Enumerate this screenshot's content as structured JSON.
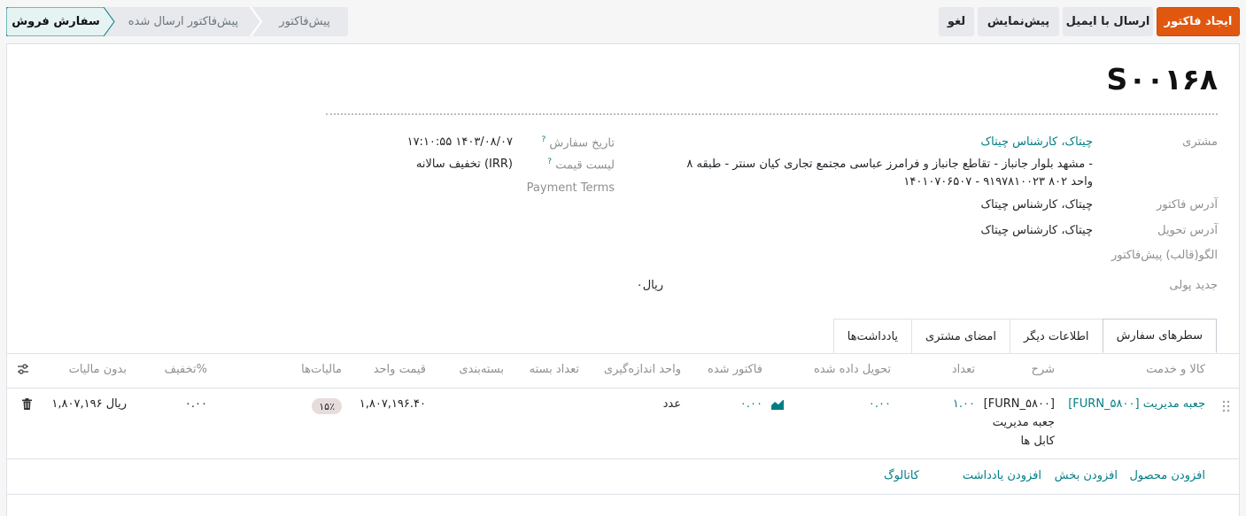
{
  "buttons": {
    "create_invoice": "ایجاد فاکتور",
    "send_email": "ارسال با ایمیل",
    "preview": "پیش‌نمایش",
    "cancel": "لغو"
  },
  "stages": {
    "items": [
      "پیش‌فاکتور",
      "پیش‌فاکتور ارسال شده",
      "سفارش فروش"
    ],
    "active": "سفارش فروش"
  },
  "form": {
    "title": "S۰۰۱۶۸",
    "customer_label": "مشتری",
    "customer_name": "چیتاک، کارشناس چیتاک",
    "customer_address_1": "مشهد بلوار جانباز - تقاطع جانباز و فرامرز عباسی مجتمع تجاری کیان سنتر - طبقه ۸ -",
    "customer_address_2": "واحد ۸۰۲ ۹۱۹۷۸۱۰۰۲۳ - ۱۴۰۱۰۷۰۶۵۰۷",
    "invoice_address_label": "آدرس فاکتور",
    "invoice_address": "چیتاک، کارشناس چیتاک",
    "delivery_address_label": "آدرس تحویل",
    "delivery_address": "چیتاک، کارشناس چیتاک",
    "quote_template_label": "الگو(قالب) پیش‌فاکتور",
    "new_money_label": "جدید پولی",
    "new_money_value": "۰ریال",
    "order_date_label": "تاریخ سفارش",
    "order_date": "۱۷:۱۰:۵۵ ۱۴۰۳/۰۸/۰۷",
    "pricelist_label": "لیست قیمت",
    "pricelist": "تخفیف سالانه (IRR)",
    "payment_terms_label": "Payment Terms",
    "help_mark": "?"
  },
  "tabs": [
    {
      "label": "سطرهای سفارش",
      "active": true
    },
    {
      "label": "اطلاعات دیگر",
      "active": false
    },
    {
      "label": "امضای مشتری",
      "active": false
    },
    {
      "label": "یادداشت‌ها",
      "active": false
    }
  ],
  "table": {
    "headers": {
      "product": "کالا و خدمت",
      "description": "شرح",
      "quantity": "تعداد",
      "delivered": "تحویل داده شده",
      "invoiced": "فاکتور شده",
      "uom": "واحد اندازه‌گیری",
      "pkg_qty": "تعداد بسته",
      "packaging": "بسته‌بندی",
      "unit_price": "قیمت واحد",
      "taxes": "مالیات‌ها",
      "discount": "تخفیف%",
      "subtotal": "بدون مالیات"
    },
    "rows": [
      {
        "product": "[FURN_۵۸۰۰] جعبه مدیریت",
        "description_1": "[FURN_۵۸۰۰]",
        "description_2": "جعبه مدیریت",
        "description_3": "کابل ها",
        "quantity": "۱.۰۰",
        "delivered": "۰.۰۰",
        "invoiced": "۰.۰۰",
        "uom": "عدد",
        "unit_price": "۱,۸۰۷,۱۹۶.۴۰",
        "tax": "۱۵٪",
        "discount": "۰.۰۰",
        "subtotal": "ریال ۱,۸۰۷,۱۹۶"
      }
    ],
    "add_links": {
      "add_product": "افزودن محصول",
      "add_section": "افزودن بخش",
      "add_note": "افزودن یادداشت",
      "catalog": "کاتالوگ"
    }
  },
  "colors": {
    "primary": "#e0580f",
    "link": "#017e84",
    "active_stage": "#e6f3f3"
  }
}
